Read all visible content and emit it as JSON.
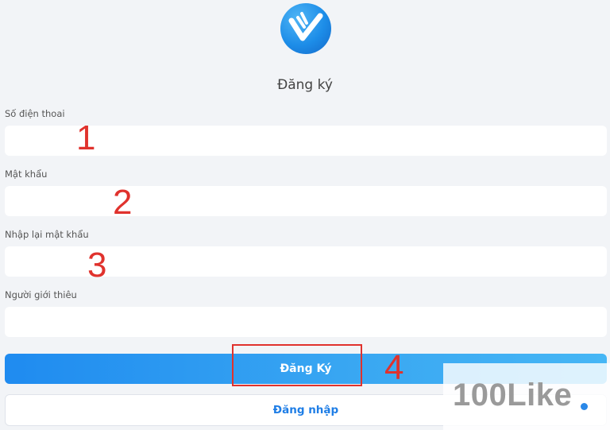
{
  "form": {
    "title": "Đăng ký",
    "fields": [
      {
        "label": "Số điện thoai",
        "value": "",
        "placeholder": ""
      },
      {
        "label": "Mật khẩu",
        "value": "",
        "placeholder": ""
      },
      {
        "label": "Nhập lại mật khẩu",
        "value": "",
        "placeholder": ""
      },
      {
        "label": "Người giới thiêu",
        "value": "",
        "placeholder": ""
      }
    ],
    "register_button": "Đăng Ký",
    "login_button": "Đăng nhập"
  },
  "annotations": [
    "1",
    "2",
    "3",
    "4"
  ],
  "watermark": {
    "text": "100Like"
  },
  "colors": {
    "accent": "#1f8bf0",
    "annotation": "#e0322d",
    "background": "#f2f4f7",
    "link": "#1f7ee6"
  },
  "icons": {
    "logo": "checkmark-thumb-logo-icon"
  }
}
